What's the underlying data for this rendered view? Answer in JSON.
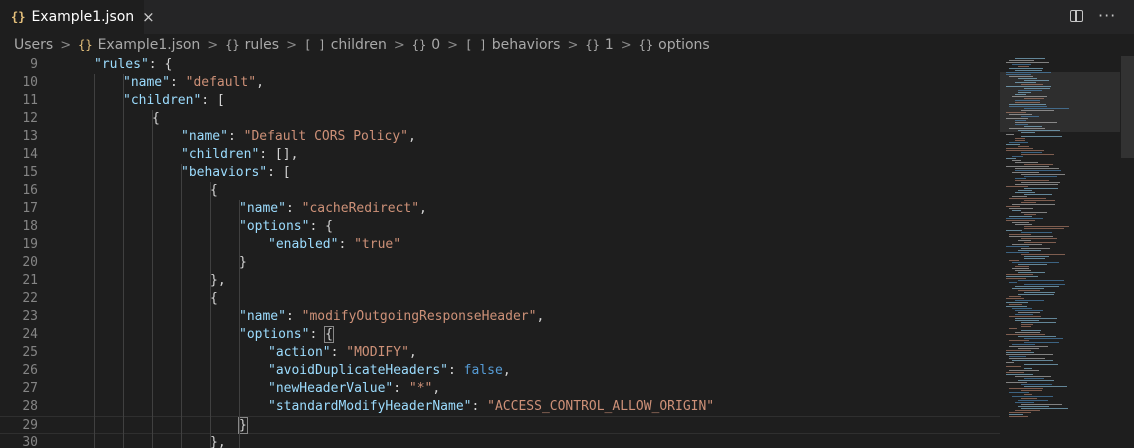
{
  "tab": {
    "icon": "{}",
    "label": "Example1.json",
    "close": "×"
  },
  "toolbar": {
    "split_icon": "split-editor-icon",
    "more": "···"
  },
  "breadcrumb": [
    {
      "icon": "",
      "label": "Users"
    },
    {
      "icon": "{}",
      "label": "Example1.json"
    },
    {
      "icon": "{}",
      "label": "rules"
    },
    {
      "icon": "[ ]",
      "label": "children"
    },
    {
      "icon": "{}",
      "label": "0"
    },
    {
      "icon": "[ ]",
      "label": "behaviors"
    },
    {
      "icon": "{}",
      "label": "1"
    },
    {
      "icon": "{}",
      "label": "options"
    }
  ],
  "breadcrumb_sep": ">",
  "colors": {
    "key": "#9cdcfe",
    "string": "#ce9178",
    "keyword": "#569cd6",
    "punct": "#d4d4d4",
    "accent": "#e5c07b"
  },
  "lines": [
    {
      "n": "9",
      "indent": 1,
      "parts": [
        [
          "k",
          "\"rules\""
        ],
        [
          "p",
          ": {"
        ]
      ]
    },
    {
      "n": "10",
      "indent": 2,
      "parts": [
        [
          "k",
          "\"name\""
        ],
        [
          "p",
          ": "
        ],
        [
          "s",
          "\"default\""
        ],
        [
          "p",
          ","
        ]
      ]
    },
    {
      "n": "11",
      "indent": 2,
      "parts": [
        [
          "k",
          "\"children\""
        ],
        [
          "p",
          ": ["
        ]
      ]
    },
    {
      "n": "12",
      "indent": 3,
      "parts": [
        [
          "p",
          "{"
        ]
      ]
    },
    {
      "n": "13",
      "indent": 4,
      "parts": [
        [
          "k",
          "\"name\""
        ],
        [
          "p",
          ": "
        ],
        [
          "s",
          "\"Default CORS Policy\""
        ],
        [
          "p",
          ","
        ]
      ]
    },
    {
      "n": "14",
      "indent": 4,
      "parts": [
        [
          "k",
          "\"children\""
        ],
        [
          "p",
          ": [],"
        ]
      ]
    },
    {
      "n": "15",
      "indent": 4,
      "parts": [
        [
          "k",
          "\"behaviors\""
        ],
        [
          "p",
          ": ["
        ]
      ]
    },
    {
      "n": "16",
      "indent": 5,
      "parts": [
        [
          "p",
          "{"
        ]
      ]
    },
    {
      "n": "17",
      "indent": 6,
      "parts": [
        [
          "k",
          "\"name\""
        ],
        [
          "p",
          ": "
        ],
        [
          "s",
          "\"cacheRedirect\""
        ],
        [
          "p",
          ","
        ]
      ]
    },
    {
      "n": "18",
      "indent": 6,
      "parts": [
        [
          "k",
          "\"options\""
        ],
        [
          "p",
          ": {"
        ]
      ]
    },
    {
      "n": "19",
      "indent": 7,
      "parts": [
        [
          "k",
          "\"enabled\""
        ],
        [
          "p",
          ": "
        ],
        [
          "s",
          "\"true\""
        ]
      ]
    },
    {
      "n": "20",
      "indent": 6,
      "parts": [
        [
          "p",
          "}"
        ]
      ]
    },
    {
      "n": "21",
      "indent": 5,
      "parts": [
        [
          "p",
          "},"
        ]
      ]
    },
    {
      "n": "22",
      "indent": 5,
      "parts": [
        [
          "p",
          "{"
        ]
      ]
    },
    {
      "n": "23",
      "indent": 6,
      "parts": [
        [
          "k",
          "\"name\""
        ],
        [
          "p",
          ": "
        ],
        [
          "s",
          "\"modifyOutgoingResponseHeader\""
        ],
        [
          "p",
          ","
        ]
      ]
    },
    {
      "n": "24",
      "indent": 6,
      "parts": [
        [
          "k",
          "\"options\""
        ],
        [
          "p",
          ": "
        ],
        [
          "bm",
          "{"
        ]
      ]
    },
    {
      "n": "25",
      "indent": 7,
      "parts": [
        [
          "k",
          "\"action\""
        ],
        [
          "p",
          ": "
        ],
        [
          "s",
          "\"MODIFY\""
        ],
        [
          "p",
          ","
        ]
      ]
    },
    {
      "n": "26",
      "indent": 7,
      "parts": [
        [
          "k",
          "\"avoidDuplicateHeaders\""
        ],
        [
          "p",
          ": "
        ],
        [
          "b",
          "false"
        ],
        [
          "p",
          ","
        ]
      ]
    },
    {
      "n": "27",
      "indent": 7,
      "parts": [
        [
          "k",
          "\"newHeaderValue\""
        ],
        [
          "p",
          ": "
        ],
        [
          "s",
          "\"*\""
        ],
        [
          "p",
          ","
        ]
      ]
    },
    {
      "n": "28",
      "indent": 7,
      "parts": [
        [
          "k",
          "\"standardModifyHeaderName\""
        ],
        [
          "p",
          ": "
        ],
        [
          "s",
          "\"ACCESS_CONTROL_ALLOW_ORIGIN\""
        ]
      ]
    },
    {
      "n": "29",
      "indent": 6,
      "parts": [
        [
          "bm",
          "}"
        ]
      ],
      "current": true
    },
    {
      "n": "30",
      "indent": 5,
      "parts": [
        [
          "p",
          "},"
        ]
      ]
    }
  ]
}
